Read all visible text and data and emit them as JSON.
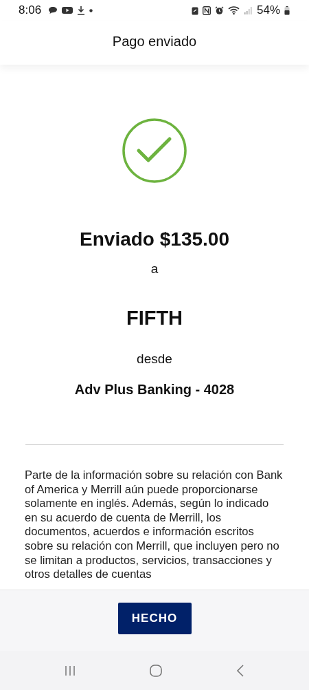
{
  "status_bar": {
    "time": "8:06",
    "battery": "54%"
  },
  "header": {
    "title": "Pago enviado"
  },
  "confirmation": {
    "amount_line": "Enviado $135.00",
    "to_word": "a",
    "recipient": "FIFTH",
    "from_word": "desde",
    "account": "Adv Plus Banking - 4028"
  },
  "disclaimer": "Parte de la información sobre su relación con Bank of America y Merrill aún puede proporcionarse solamente en inglés. Además, según lo indicado en su acuerdo de cuenta de Merrill, los documentos, acuerdos e información escritos sobre su relación con Merrill, que incluyen pero no se limitan a productos, servicios, transacciones y otros detalles de cuentas",
  "buttons": [
    {
      "label": "HECHO"
    }
  ]
}
